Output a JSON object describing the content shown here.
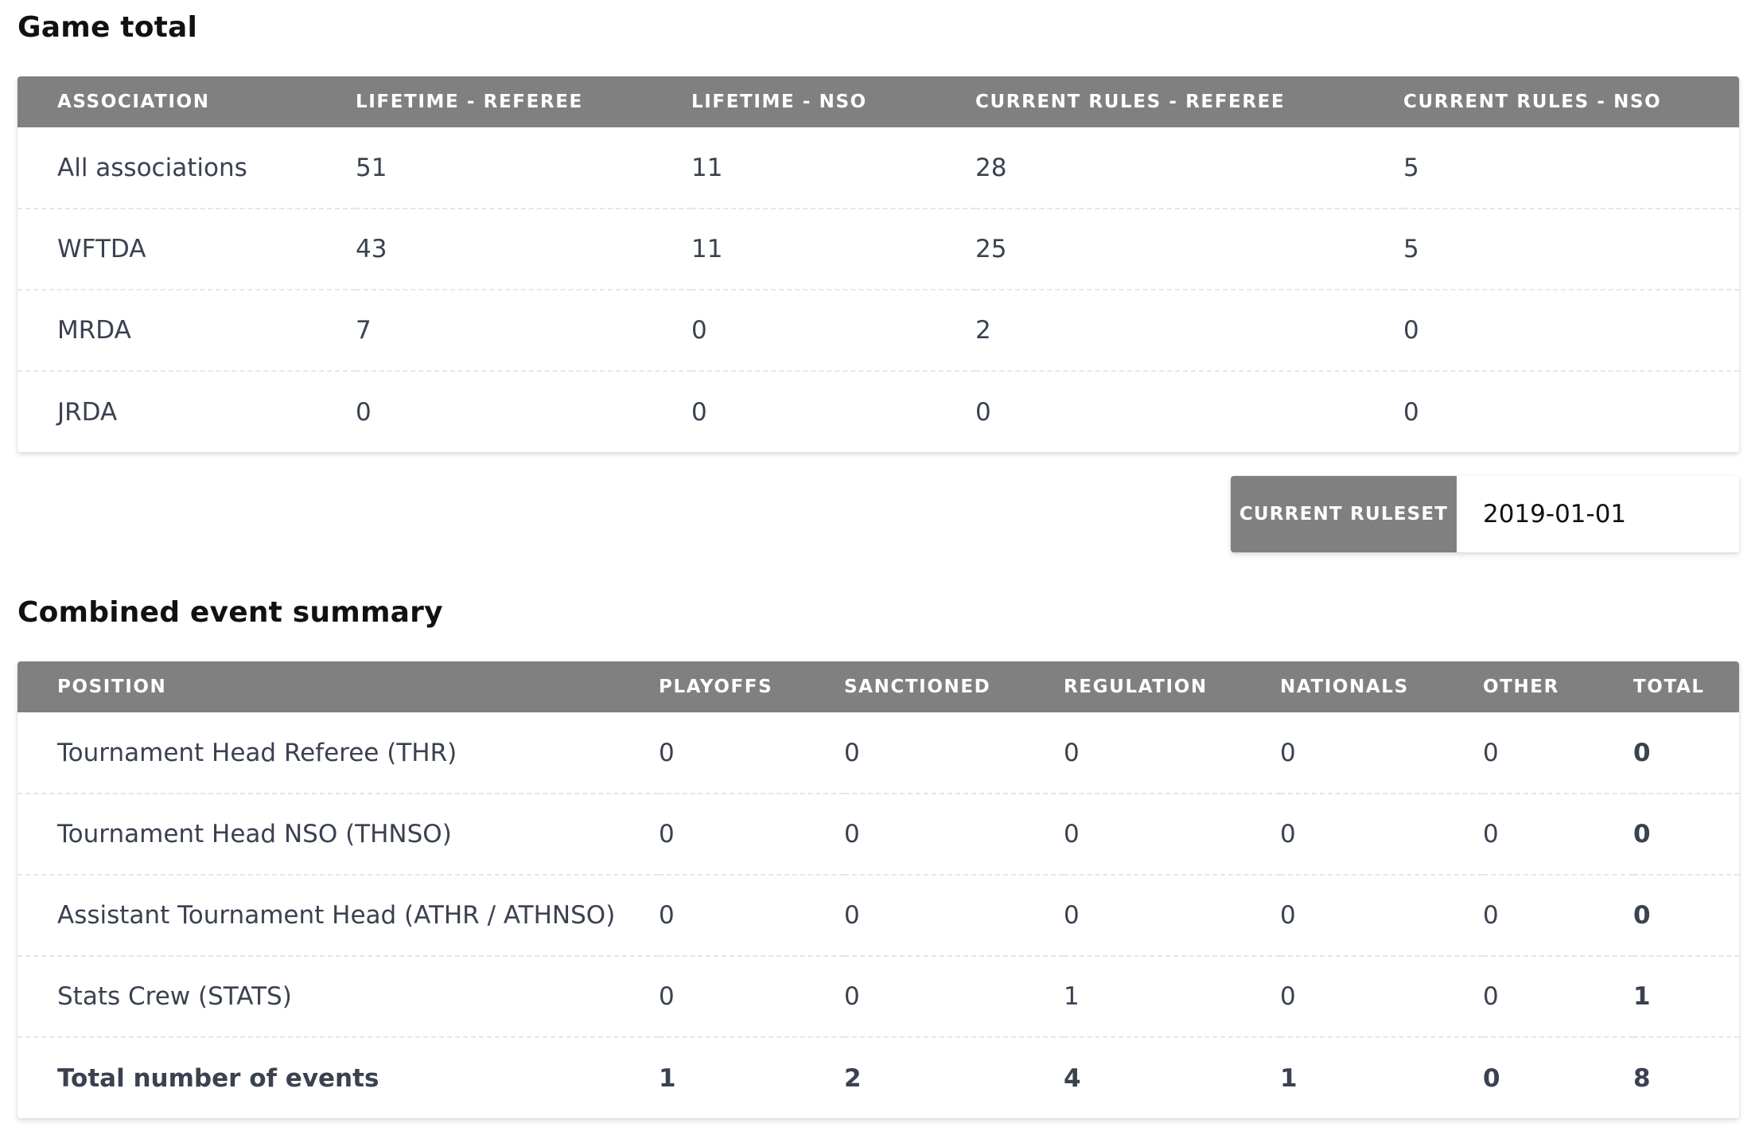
{
  "game_total": {
    "title": "Game total",
    "headers": [
      "ASSOCIATION",
      "LIFETIME - REFEREE",
      "LIFETIME - NSO",
      "CURRENT RULES - REFEREE",
      "CURRENT RULES - NSO"
    ],
    "rows": [
      [
        "All associations",
        "51",
        "11",
        "28",
        "5"
      ],
      [
        "WFTDA",
        "43",
        "11",
        "25",
        "5"
      ],
      [
        "MRDA",
        "7",
        "0",
        "2",
        "0"
      ],
      [
        "JRDA",
        "0",
        "0",
        "0",
        "0"
      ]
    ]
  },
  "ruleset": {
    "label": "CURRENT RULESET",
    "value": "2019-01-01"
  },
  "event_summary": {
    "title": "Combined event summary",
    "headers": [
      "POSITION",
      "PLAYOFFS",
      "SANCTIONED",
      "REGULATION",
      "NATIONALS",
      "OTHER",
      "TOTAL"
    ],
    "rows": [
      [
        "Tournament Head Referee (THR)",
        "0",
        "0",
        "0",
        "0",
        "0",
        "0"
      ],
      [
        "Tournament Head NSO (THNSO)",
        "0",
        "0",
        "0",
        "0",
        "0",
        "0"
      ],
      [
        "Assistant Tournament Head (ATHR / ATHNSO)",
        "0",
        "0",
        "0",
        "0",
        "0",
        "0"
      ],
      [
        "Stats Crew (STATS)",
        "0",
        "0",
        "1",
        "0",
        "0",
        "1"
      ]
    ],
    "total_row": [
      "Total number of events",
      "1",
      "2",
      "4",
      "1",
      "0",
      "8"
    ]
  }
}
